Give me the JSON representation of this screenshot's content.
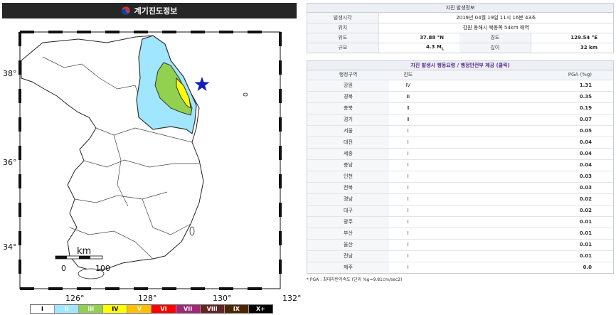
{
  "left": {
    "title": "계기진도정보",
    "lat_labels": [
      "38°",
      "36°",
      "34°"
    ],
    "lon_labels": [
      "126°",
      "128°",
      "130°",
      "132°"
    ],
    "scale": {
      "unit": "km",
      "start": "0",
      "end": "100"
    },
    "legend": [
      {
        "label": "I",
        "bg": "#ffffff",
        "fg": "#000000"
      },
      {
        "label": "II",
        "bg": "#a0e6ff",
        "fg": "#ffffff"
      },
      {
        "label": "III",
        "bg": "#92d050",
        "fg": "#ffffff"
      },
      {
        "label": "IV",
        "bg": "#ffff00",
        "fg": "#000000"
      },
      {
        "label": "V",
        "bg": "#ffc000",
        "fg": "#ffffff"
      },
      {
        "label": "VI",
        "bg": "#ff0000",
        "fg": "#ffffff"
      },
      {
        "label": "VII",
        "bg": "#a32777",
        "fg": "#ffffff"
      },
      {
        "label": "VIII",
        "bg": "#632523",
        "fg": "#ffffff"
      },
      {
        "label": "IX",
        "bg": "#4c2600",
        "fg": "#ffffff"
      },
      {
        "label": "X+",
        "bg": "#000000",
        "fg": "#ffffff"
      }
    ]
  },
  "info": {
    "header": "지진 발생정보",
    "time_label": "발생시각",
    "time_value": "2019년 04월 19일 11시 16분 43초",
    "loc_label": "위치",
    "loc_value": "강원 동해시 북동쪽 54km 해역",
    "lat_label": "위도",
    "lat_value": "37.88 °N",
    "lon_label": "경도",
    "lon_value": "129.54 °E",
    "mag_label": "규모",
    "mag_value": "4.3 M",
    "mag_sub": "L",
    "depth_label": "깊이",
    "depth_value": "32 km"
  },
  "intensity": {
    "header": "지진 발생시 행동요령 / 행정안전부 제공 (클릭)",
    "col_region": "행정구역",
    "col_intensity": "진도",
    "col_pga": "PGA (%g)",
    "rows": [
      {
        "region": "강원",
        "intensity": "Ⅳ",
        "pga": "1.31"
      },
      {
        "region": "경북",
        "intensity": "Ⅲ",
        "pga": "0.35"
      },
      {
        "region": "충북",
        "intensity": "Ⅱ",
        "pga": "0.19"
      },
      {
        "region": "경기",
        "intensity": "Ⅱ",
        "pga": "0.07"
      },
      {
        "region": "서울",
        "intensity": "Ⅰ",
        "pga": "0.05"
      },
      {
        "region": "대전",
        "intensity": "Ⅰ",
        "pga": "0.04"
      },
      {
        "region": "세종",
        "intensity": "Ⅰ",
        "pga": "0.04"
      },
      {
        "region": "충남",
        "intensity": "Ⅰ",
        "pga": "0.04"
      },
      {
        "region": "인천",
        "intensity": "Ⅰ",
        "pga": "0.03"
      },
      {
        "region": "전북",
        "intensity": "Ⅰ",
        "pga": "0.03"
      },
      {
        "region": "경남",
        "intensity": "Ⅰ",
        "pga": "0.02"
      },
      {
        "region": "대구",
        "intensity": "Ⅰ",
        "pga": "0.02"
      },
      {
        "region": "광주",
        "intensity": "Ⅰ",
        "pga": "0.01"
      },
      {
        "region": "부산",
        "intensity": "Ⅰ",
        "pga": "0.01"
      },
      {
        "region": "울산",
        "intensity": "Ⅰ",
        "pga": "0.01"
      },
      {
        "region": "전남",
        "intensity": "Ⅰ",
        "pga": "0.01"
      },
      {
        "region": "제주",
        "intensity": "Ⅰ",
        "pga": "0.0"
      }
    ],
    "footnote": "* PGA : 최대지반가속도 (단위 %g=9.81cm/sec2)"
  }
}
